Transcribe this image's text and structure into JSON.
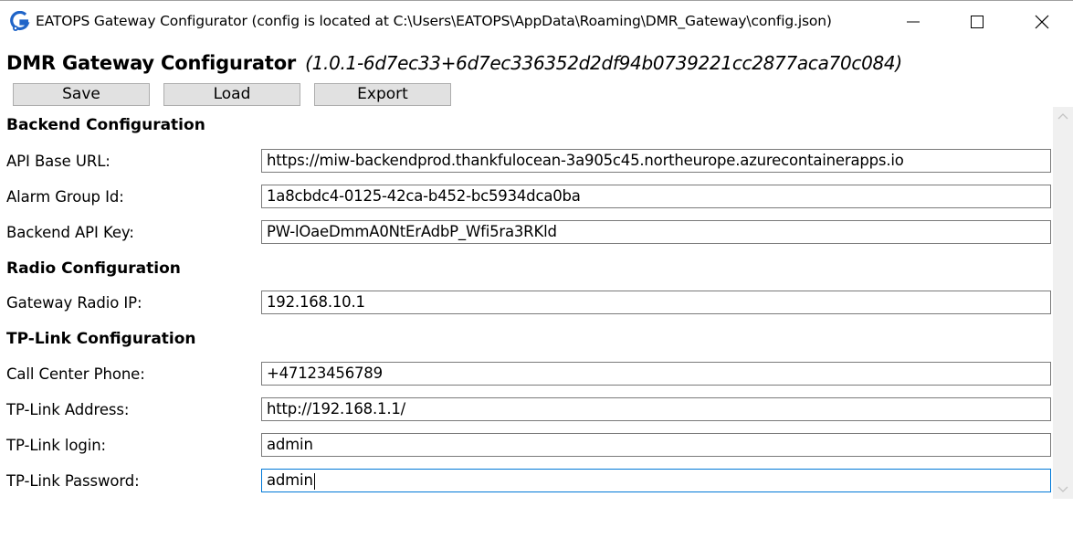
{
  "window": {
    "title": "EATOPS Gateway Configurator (config is located at C:\\Users\\EATOPS\\AppData\\Roaming\\DMR_Gateway\\config.json)",
    "icon": "app-logo-icon"
  },
  "header": {
    "app_name": "DMR Gateway Configurator",
    "version": "(1.0.1-6d7ec33+6d7ec336352d2df94b0739221cc2877aca70c084)"
  },
  "toolbar": {
    "save_label": "Save",
    "load_label": "Load",
    "export_label": "Export"
  },
  "sections": {
    "backend": {
      "title": "Backend Configuration",
      "api_base_url": {
        "label": "API Base URL:",
        "value": "https://miw-backendprod.thankfulocean-3a905c45.northeurope.azurecontainerapps.io"
      },
      "alarm_group_id": {
        "label": "Alarm Group Id:",
        "value": "1a8cbdc4-0125-42ca-b452-bc5934dca0ba"
      },
      "backend_api_key": {
        "label": "Backend API Key:",
        "value": "PW-lOaeDmmA0NtErAdbP_Wfi5ra3RKld"
      }
    },
    "radio": {
      "title": "Radio Configuration",
      "gateway_radio_ip": {
        "label": "Gateway Radio IP:",
        "value": "192.168.10.1"
      }
    },
    "tplink": {
      "title": "TP-Link Configuration",
      "call_center_phone": {
        "label": "Call Center Phone:",
        "value": "+47123456789"
      },
      "address": {
        "label": "TP-Link Address:",
        "value": "http://192.168.1.1/"
      },
      "login": {
        "label": "TP-Link login:",
        "value": "admin"
      },
      "password": {
        "label": "TP-Link Password:",
        "value": "admin"
      }
    }
  },
  "colors": {
    "focus_border": "#0078d7",
    "button_bg": "#e1e1e1",
    "scrollbar_bg": "#f0f0f0"
  }
}
